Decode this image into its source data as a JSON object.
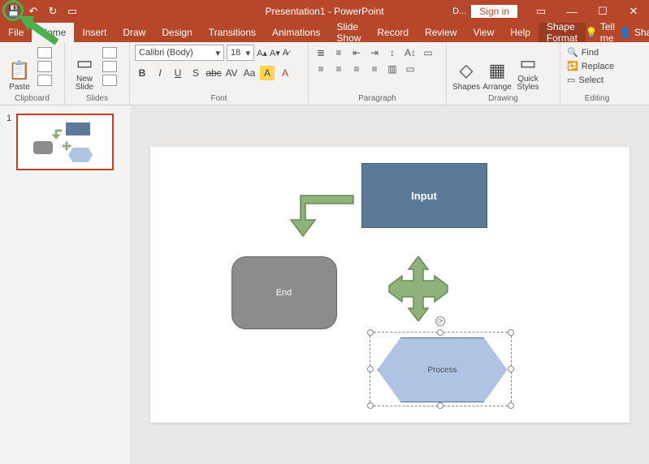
{
  "titlebar": {
    "doc_title": "Presentation1 - PowerPoint",
    "user_initial": "D...",
    "signin": "Sign in"
  },
  "qat": {
    "save": "save-icon",
    "undo": "undo-icon",
    "redo": "redo-icon",
    "start": "start-show-icon"
  },
  "menus": {
    "file": "File",
    "home": "Home",
    "insert": "Insert",
    "draw": "Draw",
    "design": "Design",
    "transitions": "Transitions",
    "animations": "Animations",
    "slideshow": "Slide Show",
    "record": "Record",
    "review": "Review",
    "view": "View",
    "help": "Help",
    "shape_format": "Shape Format",
    "tellme": "Tell me",
    "share": "Share"
  },
  "ribbon": {
    "clipboard": {
      "label": "Clipboard",
      "paste": "Paste"
    },
    "slides": {
      "label": "Slides",
      "new_slide": "New\nSlide"
    },
    "font": {
      "label": "Font",
      "family": "Calibri (Body)",
      "size": "18",
      "buttons": [
        "B",
        "I",
        "U",
        "S",
        "abc",
        "AV",
        "Aa",
        "A",
        "A",
        "A"
      ]
    },
    "paragraph": {
      "label": "Paragraph"
    },
    "drawing": {
      "label": "Drawing",
      "shapes": "Shapes",
      "arrange": "Arrange",
      "quick_styles": "Quick\nStyles"
    },
    "editing": {
      "label": "Editing",
      "find": "Find",
      "replace": "Replace",
      "select": "Select"
    }
  },
  "thumbnails": {
    "slide1_num": "1"
  },
  "slide": {
    "shapes": {
      "input": {
        "text": "Input"
      },
      "end": {
        "text": "End"
      },
      "process": {
        "text": "Process"
      }
    }
  }
}
